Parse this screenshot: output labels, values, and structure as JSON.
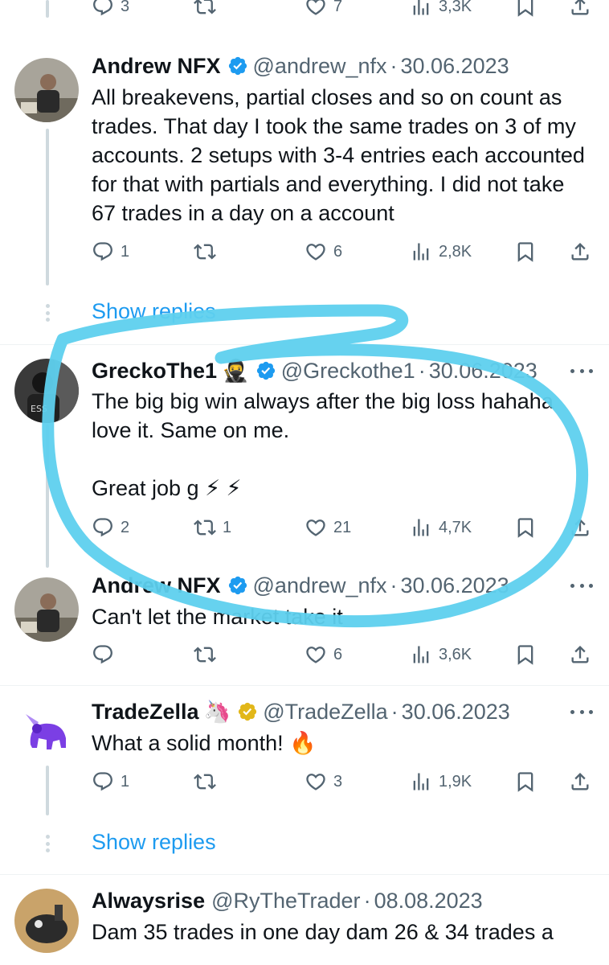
{
  "top_actions": {
    "replies": "3",
    "retweets": "",
    "likes": "7",
    "views": "3,3K"
  },
  "reply_1": {
    "name": "Andrew NFX",
    "handle": "@andrew_nfx",
    "separator": "·",
    "date": "30.06.2023",
    "text": "All breakevens, partial closes and so on count as trades. That day I took the same trades on 3 of my accounts. 2 setups with 3-4 entries each accounted for that with partials and everything. I did not take 67 trades in a day on a account",
    "replies": "1",
    "retweets": "",
    "likes": "6",
    "views": "2,8K"
  },
  "show_replies_1": "Show replies",
  "reply_2": {
    "name": "GreckoThe1",
    "name_emoji": "🥷",
    "handle": "@Greckothe1",
    "separator": "·",
    "date": "30.06.2023",
    "text": "The big big win always after the big loss hahaha love it. Same on me.\n\nGreat job g ⚡ ⚡",
    "replies": "2",
    "retweets": "1",
    "likes": "21",
    "views": "4,7K"
  },
  "reply_3": {
    "name": "Andrew NFX",
    "handle": "@andrew_nfx",
    "separator": "·",
    "date": "30.06.2023",
    "text": "Can't let the market take it",
    "replies": "",
    "retweets": "",
    "likes": "6",
    "views": "3,6K"
  },
  "reply_4": {
    "name": "TradeZella",
    "name_emoji": "🦄",
    "handle": "@TradeZella",
    "separator": "·",
    "date": "30.06.2023",
    "text": "What a solid month! 🔥",
    "replies": "1",
    "retweets": "",
    "likes": "3",
    "views": "1,9K"
  },
  "show_replies_2": "Show replies",
  "reply_5": {
    "name": "Alwaysrise",
    "handle": "@RyTheTrader",
    "separator": "·",
    "date": "08.08.2023",
    "text": "Dam 35 trades in one day dam 26 & 34 trades a"
  },
  "icons": {
    "reply": "reply-icon",
    "retweet": "retweet-icon",
    "like": "heart-icon",
    "views": "views-icon",
    "bookmark": "bookmark-icon",
    "share": "share-icon",
    "verified_blue": "verified-badge-icon",
    "verified_gold": "gold-verified-badge-icon",
    "more": "more-icon"
  },
  "colors": {
    "text": "#0f1419",
    "muted": "#536471",
    "link": "#1d9bf0",
    "verified_blue": "#1d9bf0",
    "verified_gold": "#e2b719",
    "highlight_stroke": "#5ed0ee"
  }
}
